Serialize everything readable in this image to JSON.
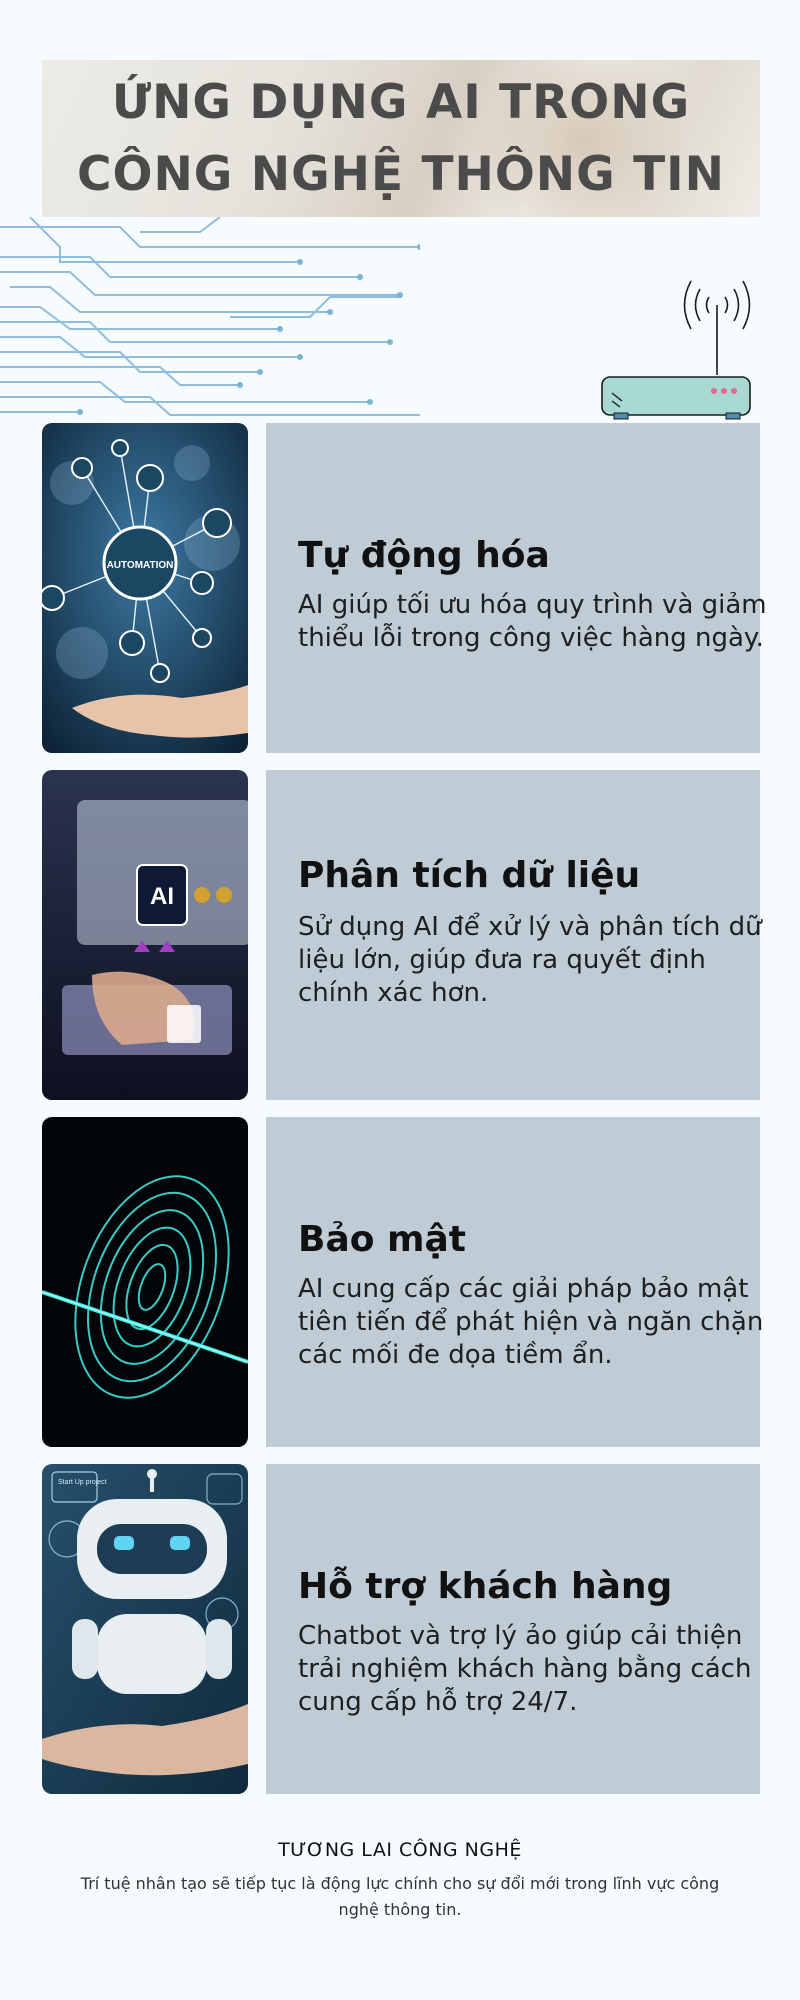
{
  "title": {
    "line1": "ỨNG DỤNG AI TRONG",
    "line2": "CÔNG NGHỆ THÔNG TIN"
  },
  "sections": [
    {
      "heading": "Tự động hóa",
      "description": "AI giúp tối ưu hóa quy trình và giảm thiểu lỗi trong công việc hàng ngày.",
      "image_label": "AUTOMATION"
    },
    {
      "heading": "Phân tích dữ liệu",
      "description": "Sử dụng AI để xử lý và phân tích dữ liệu lớn, giúp đưa ra quyết định chính xác hơn.",
      "image_label": "AI"
    },
    {
      "heading": "Bảo mật",
      "description": "AI cung cấp các giải pháp bảo mật tiên tiến để phát hiện và ngăn chặn các mối đe dọa tiềm ẩn."
    },
    {
      "heading": "Hỗ trợ khách hàng",
      "description": "Chatbot và trợ lý ảo giúp cải thiện trải nghiệm khách hàng bằng cách cung cấp hỗ trợ 24/7.",
      "image_label": "Start Up project"
    }
  ],
  "footer": {
    "title": "TƯƠNG LAI CÔNG NGHỆ",
    "text": "Trí tuệ nhân tạo sẽ tiếp tục là động lực chính cho sự đổi mới trong lĩnh vực công nghệ thông tin."
  },
  "colors": {
    "background": "#f6fbfe",
    "panel": "#bfccd6",
    "title_text": "#4b4b4b",
    "circuit": "#7fb3d6",
    "router": "#a8d8d2"
  }
}
